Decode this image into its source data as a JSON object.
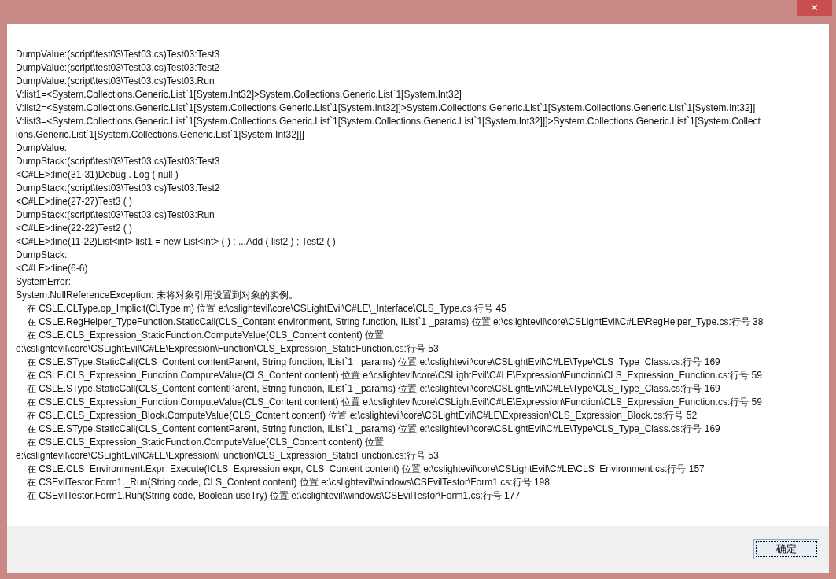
{
  "window": {
    "close_glyph": "×"
  },
  "log_lines": [
    {
      "text": "DumpValue:(script\\test03\\Test03.cs)Test03:Test3",
      "indent": false
    },
    {
      "text": "DumpValue:(script\\test03\\Test03.cs)Test03:Test2",
      "indent": false
    },
    {
      "text": "DumpValue:(script\\test03\\Test03.cs)Test03:Run",
      "indent": false
    },
    {
      "text": "V:list1=<System.Collections.Generic.List`1[System.Int32]>System.Collections.Generic.List`1[System.Int32]",
      "indent": false
    },
    {
      "text": "V:list2=<System.Collections.Generic.List`1[System.Collections.Generic.List`1[System.Int32]]>System.Collections.Generic.List`1[System.Collections.Generic.List`1[System.Int32]]",
      "indent": false
    },
    {
      "text": "V:list3=<System.Collections.Generic.List`1[System.Collections.Generic.List`1[System.Collections.Generic.List`1[System.Int32]]]>System.Collections.Generic.List`1[System.Collect",
      "indent": false
    },
    {
      "text": "ions.Generic.List`1[System.Collections.Generic.List`1[System.Int32]]]",
      "indent": false
    },
    {
      "text": "DumpValue:",
      "indent": false
    },
    {
      "text": "DumpStack:(script\\test03\\Test03.cs)Test03:Test3",
      "indent": false
    },
    {
      "text": "<C#LE>:line(31-31)Debug . Log ( null )",
      "indent": false
    },
    {
      "text": "DumpStack:(script\\test03\\Test03.cs)Test03:Test2",
      "indent": false
    },
    {
      "text": "<C#LE>:line(27-27)Test3 ( )",
      "indent": false
    },
    {
      "text": "DumpStack:(script\\test03\\Test03.cs)Test03:Run",
      "indent": false
    },
    {
      "text": "<C#LE>:line(22-22)Test2 ( )",
      "indent": false
    },
    {
      "text": "<C#LE>:line(11-22)List<int> list1 = new List<int> ( ) ; ...Add ( list2 ) ; Test2 ( )",
      "indent": false
    },
    {
      "text": "DumpStack:",
      "indent": false
    },
    {
      "text": "<C#LE>:line(6-6)",
      "indent": false
    },
    {
      "text": "SystemError:",
      "indent": false
    },
    {
      "text": "System.NullReferenceException: 未将对象引用设置到对象的实例。",
      "indent": false
    },
    {
      "text": "在 CSLE.CLType.op_Implicit(CLType m) 位置 e:\\cslightevil\\core\\CSLightEvil\\C#LE\\_Interface\\CLS_Type.cs:行号 45",
      "indent": true
    },
    {
      "text": "在 CSLE.RegHelper_TypeFunction.StaticCall(CLS_Content environment, String function, IList`1 _params) 位置 e:\\cslightevil\\core\\CSLightEvil\\C#LE\\RegHelper_Type.cs:行号 38",
      "indent": true
    },
    {
      "text": "在 CSLE.CLS_Expression_StaticFunction.ComputeValue(CLS_Content content) 位置",
      "indent": true
    },
    {
      "text": "e:\\cslightevil\\core\\CSLightEvil\\C#LE\\Expression\\Function\\CLS_Expression_StaticFunction.cs:行号 53",
      "indent": false
    },
    {
      "text": "在 CSLE.SType.StaticCall(CLS_Content contentParent, String function, IList`1 _params) 位置 e:\\cslightevil\\core\\CSLightEvil\\C#LE\\Type\\CLS_Type_Class.cs:行号 169",
      "indent": true
    },
    {
      "text": "在 CSLE.CLS_Expression_Function.ComputeValue(CLS_Content content) 位置 e:\\cslightevil\\core\\CSLightEvil\\C#LE\\Expression\\Function\\CLS_Expression_Function.cs:行号 59",
      "indent": true
    },
    {
      "text": "在 CSLE.SType.StaticCall(CLS_Content contentParent, String function, IList`1 _params) 位置 e:\\cslightevil\\core\\CSLightEvil\\C#LE\\Type\\CLS_Type_Class.cs:行号 169",
      "indent": true
    },
    {
      "text": "在 CSLE.CLS_Expression_Function.ComputeValue(CLS_Content content) 位置 e:\\cslightevil\\core\\CSLightEvil\\C#LE\\Expression\\Function\\CLS_Expression_Function.cs:行号 59",
      "indent": true
    },
    {
      "text": "在 CSLE.CLS_Expression_Block.ComputeValue(CLS_Content content) 位置 e:\\cslightevil\\core\\CSLightEvil\\C#LE\\Expression\\CLS_Expression_Block.cs:行号 52",
      "indent": true
    },
    {
      "text": "在 CSLE.SType.StaticCall(CLS_Content contentParent, String function, IList`1 _params) 位置 e:\\cslightevil\\core\\CSLightEvil\\C#LE\\Type\\CLS_Type_Class.cs:行号 169",
      "indent": true
    },
    {
      "text": "在 CSLE.CLS_Expression_StaticFunction.ComputeValue(CLS_Content content) 位置",
      "indent": true
    },
    {
      "text": "e:\\cslightevil\\core\\CSLightEvil\\C#LE\\Expression\\Function\\CLS_Expression_StaticFunction.cs:行号 53",
      "indent": false
    },
    {
      "text": "在 CSLE.CLS_Environment.Expr_Execute(ICLS_Expression expr, CLS_Content content) 位置 e:\\cslightevil\\core\\CSLightEvil\\C#LE\\CLS_Environment.cs:行号 157",
      "indent": true
    },
    {
      "text": "在 CSEvilTestor.Form1._Run(String code, CLS_Content content) 位置 e:\\cslightevil\\windows\\CSEvilTestor\\Form1.cs:行号 198",
      "indent": true
    },
    {
      "text": "在 CSEvilTestor.Form1.Run(String code, Boolean useTry) 位置 e:\\cslightevil\\windows\\CSEvilTestor\\Form1.cs:行号 177",
      "indent": true
    }
  ],
  "buttons": [
    {
      "label": "确定",
      "focused": true
    }
  ]
}
